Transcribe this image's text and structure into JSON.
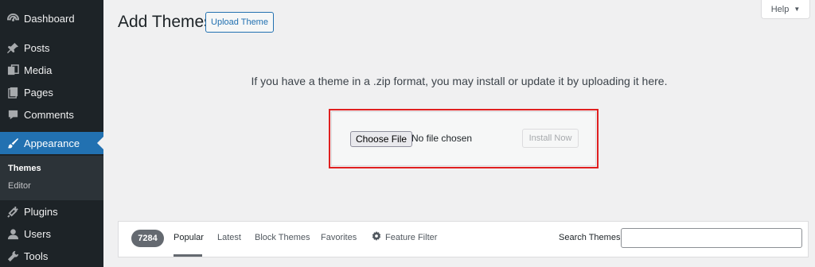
{
  "sidebar": {
    "items": [
      {
        "label": "Dashboard",
        "icon": "dashboard-icon"
      },
      {
        "label": "Posts",
        "icon": "pin-icon"
      },
      {
        "label": "Media",
        "icon": "media-icon"
      },
      {
        "label": "Pages",
        "icon": "pages-icon"
      },
      {
        "label": "Comments",
        "icon": "comments-icon"
      },
      {
        "label": "Appearance",
        "icon": "brush-icon",
        "active": true
      },
      {
        "label": "Plugins",
        "icon": "plug-icon"
      },
      {
        "label": "Users",
        "icon": "user-icon"
      },
      {
        "label": "Tools",
        "icon": "wrench-icon"
      }
    ],
    "submenu": [
      "Themes",
      "Editor"
    ]
  },
  "header": {
    "title": "Add Themes",
    "upload_label": "Upload Theme",
    "help_label": "Help"
  },
  "upload": {
    "intro": "If you have a theme in a .zip format, you may install or update it by uploading it here.",
    "choose_label": "Choose File",
    "file_status": "No file chosen",
    "install_label": "Install Now"
  },
  "filter": {
    "count": "7284",
    "tabs": [
      "Popular",
      "Latest",
      "Block Themes",
      "Favorites"
    ],
    "feature_filter": "Feature Filter",
    "search_label": "Search Themes",
    "search_value": ""
  },
  "colors": {
    "sidebar_bg": "#1d2327",
    "accent": "#2271b1",
    "highlight_outline": "#e02020"
  }
}
